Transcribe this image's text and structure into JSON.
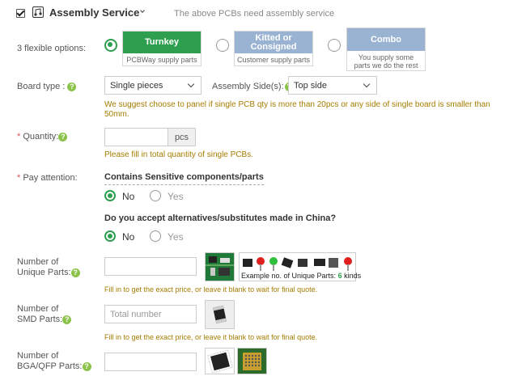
{
  "header": {
    "checked": true,
    "title": "Assembly Service",
    "subtitle": "The above PCBs need assembly service"
  },
  "options": {
    "label": "3 flexible options:",
    "items": [
      {
        "title": "Turnkey",
        "subtitle": "PCBWay supply parts",
        "color": "#2e9e4f",
        "selected": true
      },
      {
        "title": "Kitted or Consigned",
        "subtitle": "Customer supply parts",
        "color": "#9bb3d3",
        "selected": false
      },
      {
        "title": "Combo",
        "subtitle": "You supply some parts we do the rest",
        "color": "#9bb3d3",
        "selected": false
      }
    ]
  },
  "board_type": {
    "label": "Board type :",
    "value": "Single pieces",
    "sides_label": "Assembly Side(s):",
    "sides_value": "Top side",
    "note": "We suggest choose to panel if single PCB qty is more than 20pcs or any side of single board is smaller than 50mm."
  },
  "quantity": {
    "label": "Quantity:",
    "unit": "pcs",
    "note": "Please fill in total quantity of single PCBs."
  },
  "attention": {
    "label": "Pay attention:",
    "q1": "Contains Sensitive components/parts",
    "q2": "Do you accept alternatives/substitutes made in China?",
    "no": "No",
    "yes": "Yes"
  },
  "unique_parts": {
    "label1": "Number of",
    "label2": "Unique Parts:",
    "example_prefix": "Example no. of Unique Parts:",
    "example_count": "6",
    "example_suffix": "kinds",
    "note": "Fill in to get the exact price, or leave it blank to wait for final quote."
  },
  "smd_parts": {
    "label1": "Number of",
    "label2": "SMD Parts:",
    "placeholder": "Total number",
    "note": "Fill in to get the exact price, or leave it blank to wait for final quote."
  },
  "bga_parts": {
    "label1": "Number of",
    "label2": "BGA/QFP Parts:"
  },
  "help_glyph": "?",
  "colors": {
    "accent": "#2e9e4f",
    "note": "#a67c00",
    "required": "#d9534f",
    "help": "#8bc34a"
  }
}
